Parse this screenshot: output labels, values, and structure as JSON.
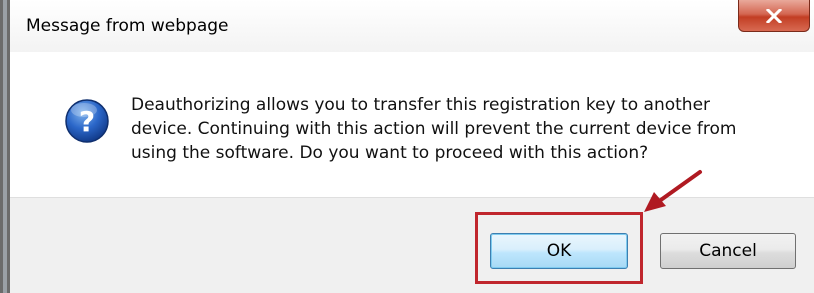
{
  "window": {
    "title": "Message from webpage",
    "close_icon": "close-icon"
  },
  "dialog": {
    "icon": "question-icon",
    "message": "Deauthorizing allows you to transfer this registration key to another device. Continuing with this action will prevent the current device from using the software. Do you want to proceed with this action?"
  },
  "buttons": {
    "ok_label": "OK",
    "cancel_label": "Cancel"
  },
  "annotation": {
    "arrow_icon": "red-arrow-icon",
    "highlight_color": "#c0262d"
  },
  "colors": {
    "close_button": "#c23e24",
    "ok_border": "#3c7fb1",
    "footer_bg": "#f0f0f0"
  }
}
